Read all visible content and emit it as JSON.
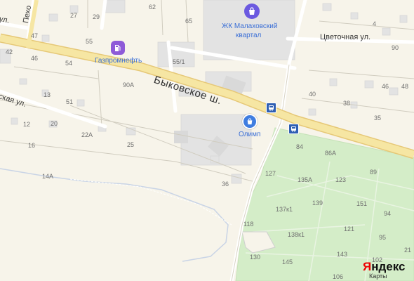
{
  "streets": {
    "main": "Быковское ш.",
    "tsvetochnaya": "Цветочная ул.",
    "left_ul": "ская ул.",
    "left_ul_top": "ул.",
    "vertical": "Пехо"
  },
  "pois": {
    "zhk": {
      "name_line1": "ЖК Малаховский",
      "name_line2": "квартал",
      "icon": "shopping-bag-icon"
    },
    "gas": {
      "name": "Газпромнефть",
      "icon": "fuel-pump-icon"
    },
    "olimp": {
      "name": "Олимп",
      "icon": "shopping-bag-icon"
    }
  },
  "house_numbers": {
    "n27": "27",
    "n29": "29",
    "n62": "62",
    "n65": "65",
    "n47": "47",
    "n55": "55",
    "n42": "42",
    "n46": "46",
    "n54": "54",
    "n551": "55/1",
    "n90a": "90А",
    "n13": "13",
    "n51": "51",
    "n12": "12",
    "n20": "20",
    "n22a": "22А",
    "n16": "16",
    "n25": "25",
    "n14a": "14А",
    "n36": "36",
    "n4": "4",
    "n90": "90",
    "n40": "40",
    "n46b": "46",
    "n48": "48",
    "n38": "38",
    "n35": "35",
    "n84": "84",
    "n86a": "86А",
    "n89": "89",
    "n127": "127",
    "n135a": "135А",
    "n123": "123",
    "n139": "139",
    "n151": "151",
    "n137k1": "137к1",
    "n94": "94",
    "n118": "118",
    "n138k1": "138к1",
    "n121": "121",
    "n95": "95",
    "n143": "143",
    "n130": "130",
    "n145": "145",
    "n106": "106",
    "n102": "102",
    "n21": "21"
  },
  "transit": {
    "stop_icon": "bus-stop-icon"
  },
  "branding": {
    "logo_first": "Я",
    "logo_rest": "ндекс",
    "logo_sub": "Карты"
  },
  "colors": {
    "background": "#f7f4ea",
    "forest": "#d4edc8",
    "main_road_fill": "#f6e6a3",
    "main_road_edge": "#e6c877",
    "minor_road": "#ffffff",
    "block": "#e3e3e3",
    "poi_blue": "#3b6fd6",
    "logo_red": "#ee0000"
  }
}
